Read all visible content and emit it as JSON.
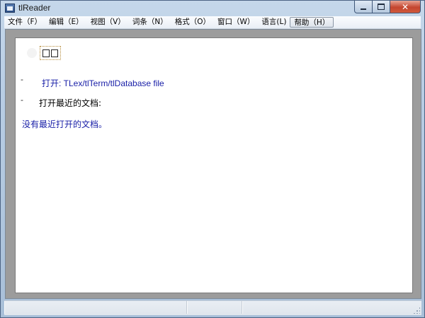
{
  "window": {
    "title": "tlReader"
  },
  "menubar": {
    "items": [
      {
        "label": "文件（F）"
      },
      {
        "label": "编辑（E）"
      },
      {
        "label": "视图（V）"
      },
      {
        "label": "词条（N）"
      },
      {
        "label": "格式（O）"
      },
      {
        "label": "窗口（W）"
      },
      {
        "label": "语言(L)"
      },
      {
        "label": "帮助（H）"
      }
    ]
  },
  "content": {
    "logo_text": "",
    "open_prefix": "打开:",
    "open_link": "打开: TLex/tlTerm/tlDatabase file",
    "bullet": "-",
    "recent_heading": "打开最近的文档:",
    "no_recent": "没有最近打开的文档。"
  },
  "statusbar": {
    "panes": [
      "",
      "",
      ""
    ]
  }
}
